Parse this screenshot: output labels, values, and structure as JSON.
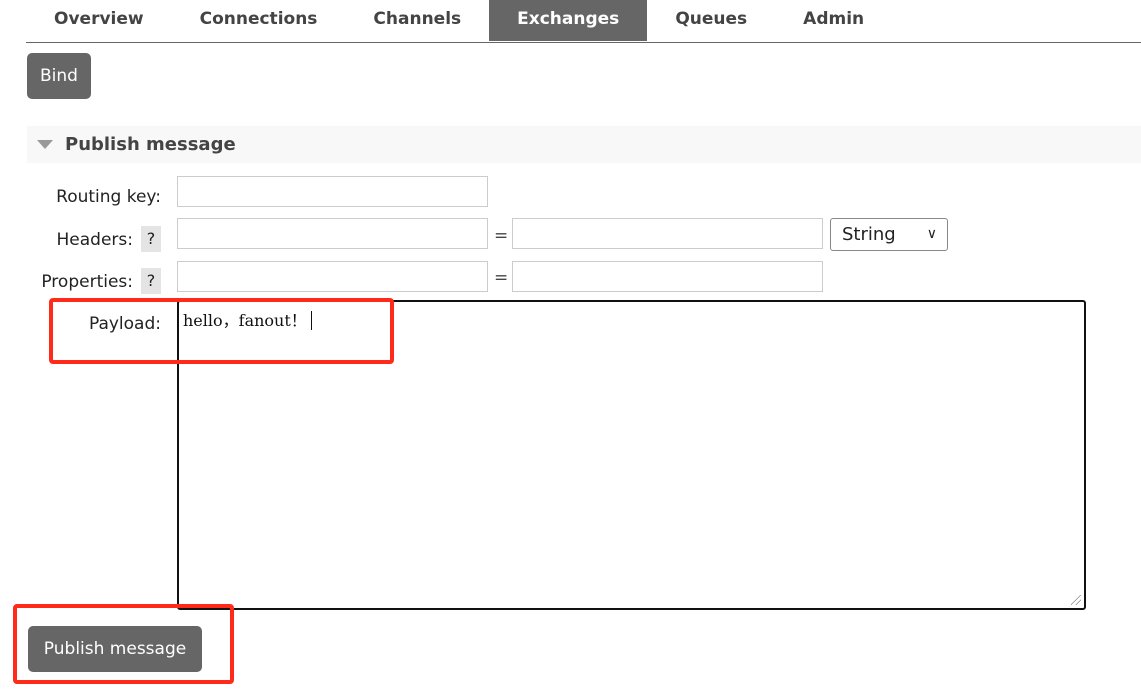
{
  "tabs": [
    {
      "label": "Overview"
    },
    {
      "label": "Connections"
    },
    {
      "label": "Channels"
    },
    {
      "label": "Exchanges",
      "active": true
    },
    {
      "label": "Queues"
    },
    {
      "label": "Admin"
    }
  ],
  "bind_label": "Bind",
  "section": {
    "title": "Publish message",
    "icon": "triangle-down-icon"
  },
  "form": {
    "routing_key_label": "Routing key:",
    "headers_label": "Headers:",
    "properties_label": "Properties:",
    "help": "?",
    "equals": "=",
    "type_select": "String",
    "payload_label": "Payload:",
    "payload_value": "hello，fanout！"
  },
  "publish_label": "Publish message",
  "colors": {
    "accent": "#666666",
    "highlight": "#ff2a1a"
  }
}
